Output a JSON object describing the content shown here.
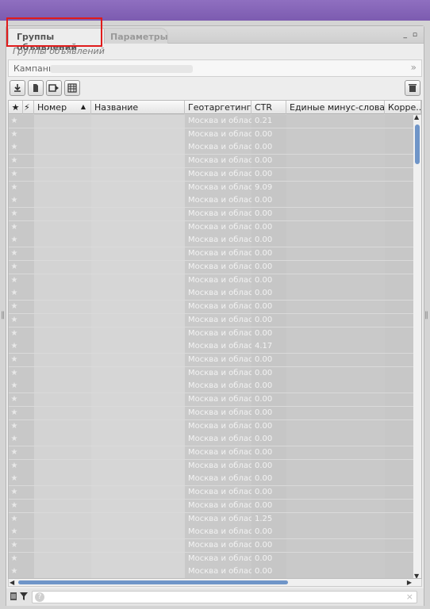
{
  "tabs": [
    {
      "label": "Группы объявлений"
    },
    {
      "label": "Параметры"
    }
  ],
  "panel": {
    "subtitle": "Группы объявлений",
    "window_buttons": "_ ▫"
  },
  "campaign": {
    "label": "Кампания",
    "chevron": "»"
  },
  "toolbar": {
    "icons": [
      "download-icon",
      "document-icon",
      "export-icon",
      "table-icon",
      "trash-icon"
    ]
  },
  "table": {
    "headers": [
      "★",
      "⚡",
      "Номер",
      "Название",
      "Геотаргетинг",
      "CTR",
      "Единые минус-слова",
      "Корре..."
    ],
    "sort_indicator": "▲",
    "rows": [
      {
        "geo": "Москва и облас",
        "ctr": "0.21"
      },
      {
        "geo": "Москва и облас",
        "ctr": "0.00"
      },
      {
        "geo": "Москва и облас",
        "ctr": "0.00"
      },
      {
        "geo": "Москва и облас",
        "ctr": "0.00"
      },
      {
        "geo": "Москва и облас",
        "ctr": "0.00"
      },
      {
        "geo": "Москва и облас",
        "ctr": "9.09"
      },
      {
        "geo": "Москва и облас",
        "ctr": "0.00"
      },
      {
        "geo": "Москва и облас",
        "ctr": "0.00"
      },
      {
        "geo": "Москва и облас",
        "ctr": "0.00"
      },
      {
        "geo": "Москва и облас",
        "ctr": "0.00"
      },
      {
        "geo": "Москва и облас",
        "ctr": "0.00"
      },
      {
        "geo": "Москва и облас",
        "ctr": "0.00"
      },
      {
        "geo": "Москва и облас",
        "ctr": "0.00"
      },
      {
        "geo": "Москва и облас",
        "ctr": "0.00"
      },
      {
        "geo": "Москва и облас",
        "ctr": "0.00"
      },
      {
        "geo": "Москва и облас",
        "ctr": "0.00"
      },
      {
        "geo": "Москва и облас",
        "ctr": "0.00"
      },
      {
        "geo": "Москва и облас",
        "ctr": "4.17"
      },
      {
        "geo": "Москва и облас",
        "ctr": "0.00"
      },
      {
        "geo": "Москва и облас",
        "ctr": "0.00"
      },
      {
        "geo": "Москва и облас",
        "ctr": "0.00"
      },
      {
        "geo": "Москва и облас",
        "ctr": "0.00"
      },
      {
        "geo": "Москва и облас",
        "ctr": "0.00"
      },
      {
        "geo": "Москва и облас",
        "ctr": "0.00"
      },
      {
        "geo": "Москва и облас",
        "ctr": "0.00"
      },
      {
        "geo": "Москва и облас",
        "ctr": "0.00"
      },
      {
        "geo": "Москва и облас",
        "ctr": "0.00"
      },
      {
        "geo": "Москва и облас",
        "ctr": "0.00"
      },
      {
        "geo": "Москва и облас",
        "ctr": "0.00"
      },
      {
        "geo": "Москва и облас",
        "ctr": "0.00"
      },
      {
        "geo": "Москва и облас",
        "ctr": "1.25"
      },
      {
        "geo": "Москва и облас",
        "ctr": "0.00"
      },
      {
        "geo": "Москва и облас",
        "ctr": "0.00"
      },
      {
        "geo": "Москва и облас",
        "ctr": "0.00"
      },
      {
        "geo": "Москва и облас",
        "ctr": "0.00"
      }
    ]
  },
  "footer": {
    "search_icon": "?",
    "clear": "×"
  },
  "colors": {
    "accent": "#7c5bb0",
    "highlight": "#e01b1b",
    "scrollbar": "#6f95c8"
  }
}
